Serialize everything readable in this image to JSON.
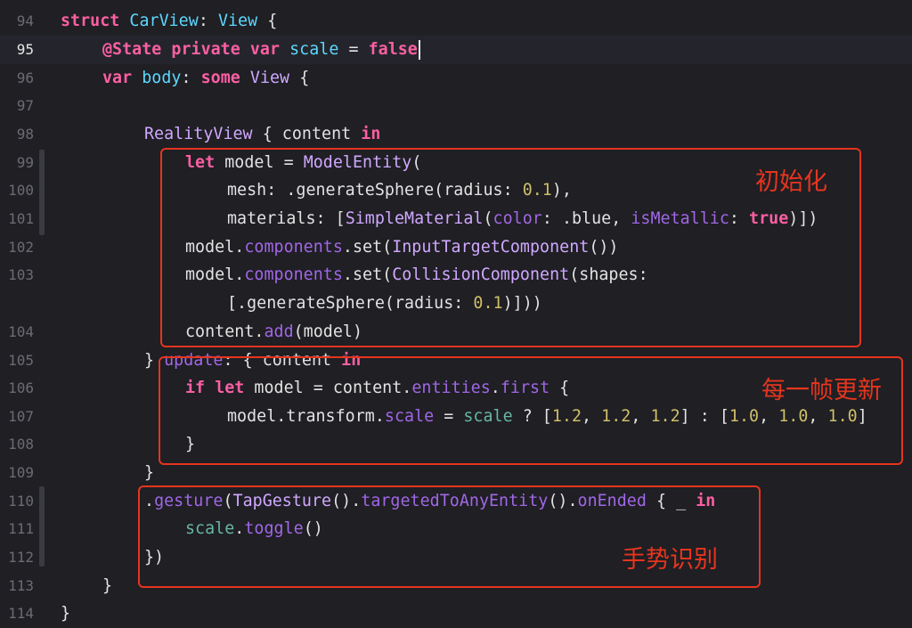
{
  "editor": {
    "active_line": "95",
    "lines": [
      {
        "num": "94"
      },
      {
        "num": "95"
      },
      {
        "num": "96"
      },
      {
        "num": "97"
      },
      {
        "num": "98"
      },
      {
        "num": "99"
      },
      {
        "num": "100"
      },
      {
        "num": "101"
      },
      {
        "num": "102"
      },
      {
        "num": "103"
      },
      {
        "num": ""
      },
      {
        "num": "104"
      },
      {
        "num": "105"
      },
      {
        "num": "106"
      },
      {
        "num": "107"
      },
      {
        "num": "108"
      },
      {
        "num": "109"
      },
      {
        "num": "110"
      },
      {
        "num": "111"
      },
      {
        "num": "112"
      },
      {
        "num": "113"
      },
      {
        "num": "114"
      }
    ],
    "code": {
      "l94": {
        "a": "struct",
        "b": "CarView",
        "c": ":",
        "d": "View",
        "e": "{"
      },
      "l95": {
        "a": "@State",
        "b": "private",
        "c": "var",
        "d": "scale",
        "e": "=",
        "f": "false"
      },
      "l96": {
        "a": "var",
        "b": "body",
        "c": ":",
        "d": "some",
        "e": "View",
        "f": "{"
      },
      "l98": {
        "a": "RealityView",
        "b": "{ content",
        "c": "in"
      },
      "l99": {
        "a": "let",
        "b": "model = ",
        "c": "ModelEntity",
        "d": "("
      },
      "l100": {
        "a": "mesh: .generateSphere(radius: ",
        "b": "0.1",
        "c": "),"
      },
      "l101": {
        "a": "materials: [",
        "b": "SimpleMaterial",
        "c": "(",
        "d": "color",
        "e": ": .blue, ",
        "f": "isMetallic",
        "g": ": ",
        "h": "true",
        "i": ")])"
      },
      "l102": {
        "a": "model.",
        "b": "components",
        "c": ".set(",
        "d": "InputTargetComponent",
        "e": "())"
      },
      "l103": {
        "a": "model.",
        "b": "components",
        "c": ".set(",
        "d": "CollisionComponent",
        "e": "(shapes:"
      },
      "l103b": {
        "a": "[.generateSphere(radius: ",
        "b": "0.1",
        "c": ")]))"
      },
      "l104": {
        "a": "content.",
        "b": "add",
        "c": "(model)"
      },
      "l105": {
        "a": "} ",
        "b": "update",
        "c": ": { content ",
        "d": "in"
      },
      "l106": {
        "a": "if",
        "b": "let",
        "c": "model = content.",
        "d": "entities",
        "e": ".",
        "f": "first",
        "g": " {"
      },
      "l107": {
        "a": "model.transform.",
        "b": "scale",
        "c": " = ",
        "d": "scale",
        "e": " ? [",
        "f": "1.2",
        "g": ", ",
        "h": "1.2",
        "i": ", ",
        "j": "1.2",
        "k": "] : [",
        "l": "1.0",
        "m": ", ",
        "n": "1.0",
        "o": ", ",
        "p": "1.0",
        "q": "]"
      },
      "l108": {
        "a": "}"
      },
      "l109": {
        "a": "}"
      },
      "l110": {
        "a": ".",
        "b": "gesture",
        "c": "(",
        "d": "TapGesture",
        "e": "().",
        "f": "targetedToAnyEntity",
        "g": "().",
        "h": "onEnded",
        "i": " { _ ",
        "j": "in"
      },
      "l111": {
        "a": "scale",
        "b": ".",
        "c": "toggle",
        "d": "()"
      },
      "l112": {
        "a": "})"
      },
      "l113": {
        "a": "}"
      },
      "l114": {
        "a": "}"
      }
    }
  },
  "annotations": {
    "init_label": "初始化",
    "update_label": "每一帧更新",
    "gesture_label": "手势识别",
    "color": "#e6351e"
  }
}
